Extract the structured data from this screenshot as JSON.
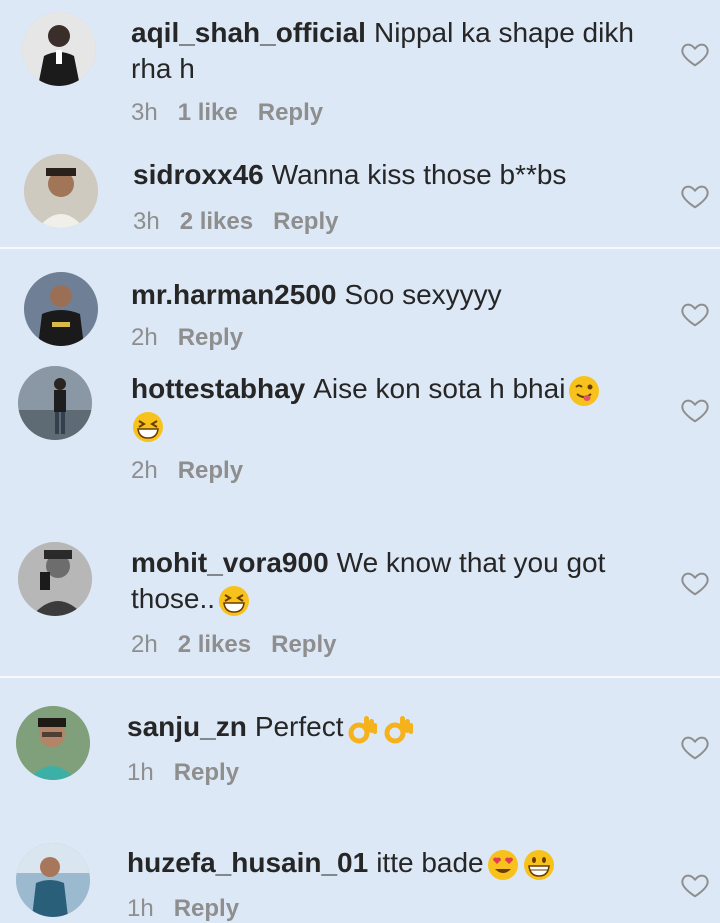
{
  "comments": [
    {
      "username": "aqil_shah_official",
      "text": "Nippal ka shape dikh rha h",
      "time": "3h",
      "likes": "1 like",
      "reply": "Reply"
    },
    {
      "username": "sidroxx46",
      "text": "Wanna kiss those b**bs",
      "time": "3h",
      "likes": "2 likes",
      "reply": "Reply"
    },
    {
      "username": "mr.harman2500",
      "text": "Soo sexyyyy",
      "time": "2h",
      "likes": "",
      "reply": "Reply"
    },
    {
      "username": "hottestabhay",
      "text": "Aise kon sota h bhai",
      "time": "2h",
      "likes": "",
      "reply": "Reply"
    },
    {
      "username": "mohit_vora900",
      "text": "We know that you got those..",
      "time": "2h",
      "likes": "2 likes",
      "reply": "Reply"
    },
    {
      "username": "sanju_zn",
      "text": "Perfect",
      "time": "1h",
      "likes": "",
      "reply": "Reply"
    },
    {
      "username": "huzefa_husain_01",
      "text": "itte bade",
      "time": "1h",
      "likes": "",
      "reply": "Reply"
    }
  ],
  "colors": {
    "background": "#dde8f6",
    "divider": "#f7f9fc",
    "meta": "#8e8e8e",
    "text": "#262626"
  },
  "icons": {
    "like": "heart-outline-icon"
  }
}
